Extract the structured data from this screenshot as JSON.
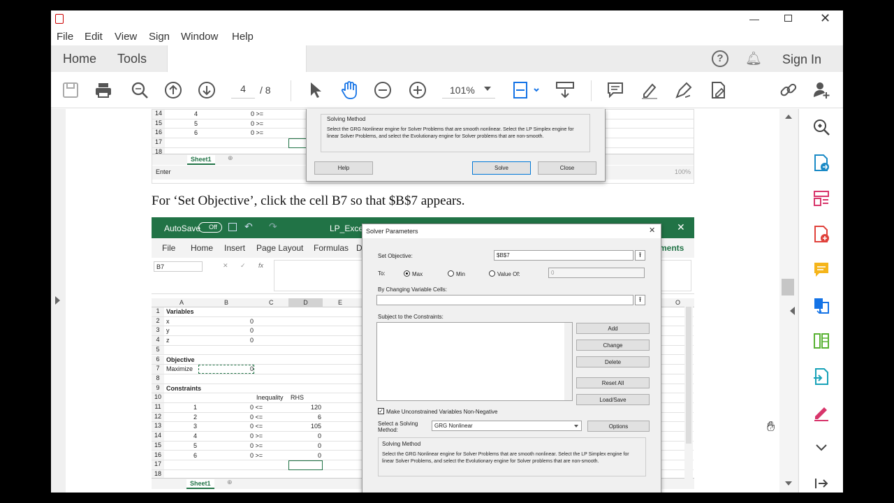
{
  "menu": [
    "File",
    "Edit",
    "View",
    "Sign",
    "Window",
    "Help"
  ],
  "tabs": {
    "home": "Home",
    "tools": "Tools"
  },
  "header": {
    "sign_in": "Sign In"
  },
  "toolbar": {
    "page_current": "4",
    "page_sep": "/ 8",
    "zoom": "101%"
  },
  "top_excel": {
    "rows": [
      {
        "n": "14",
        "a": "4",
        "b": "0 >="
      },
      {
        "n": "15",
        "a": "5",
        "b": "0 >="
      },
      {
        "n": "16",
        "a": "6",
        "b": "0 >="
      },
      {
        "n": "17",
        "a": "",
        "b": ""
      },
      {
        "n": "18",
        "a": "",
        "b": ""
      }
    ],
    "sheet_tab": "Sheet1",
    "status": "Enter",
    "zoom_status": "100%"
  },
  "top_dialog": {
    "section": "Solving Method",
    "desc": "Select the GRG Nonlinear engine for Solver Problems that are smooth nonlinear. Select the LP Simplex engine for linear Solver Problems, and select the Evolutionary engine for Solver problems that are non-smooth.",
    "help": "Help",
    "solve": "Solve",
    "close": "Close"
  },
  "instruction": "For ‘Set Objective’, click the cell B7 so that $B$7 appears.",
  "excel": {
    "autosave": "AutoSave",
    "toggle": "Off",
    "file": "LP_ExcelS",
    "ribbon": [
      "File",
      "Home",
      "Insert",
      "Page Layout",
      "Formulas",
      "D"
    ],
    "ribbon_right": "ments",
    "namebox": "B7",
    "cols": [
      "A",
      "B",
      "C",
      "D",
      "E"
    ],
    "col_o": "O",
    "rows": [
      {
        "n": "1",
        "a": "Variables",
        "b": "",
        "c": "",
        "d": "",
        "bold": true
      },
      {
        "n": "2",
        "a": "x",
        "b": "0",
        "c": "",
        "d": ""
      },
      {
        "n": "3",
        "a": "y",
        "b": "0",
        "c": "",
        "d": ""
      },
      {
        "n": "4",
        "a": "z",
        "b": "0",
        "c": "",
        "d": ""
      },
      {
        "n": "5",
        "a": "",
        "b": "",
        "c": "",
        "d": ""
      },
      {
        "n": "6",
        "a": "Objective",
        "b": "",
        "c": "",
        "d": "",
        "bold": true
      },
      {
        "n": "7",
        "a": "Maximize",
        "b": "0",
        "c": "",
        "d": ""
      },
      {
        "n": "8",
        "a": "",
        "b": "",
        "c": "",
        "d": ""
      },
      {
        "n": "9",
        "a": "Constraints",
        "b": "",
        "c": "",
        "d": "",
        "bold": true
      },
      {
        "n": "10",
        "a": "",
        "b": "",
        "c": "Inequality",
        "d": "RHS"
      },
      {
        "n": "11",
        "a": "1",
        "b": "0 <=",
        "c": "",
        "d": "120"
      },
      {
        "n": "12",
        "a": "2",
        "b": "0 <=",
        "c": "",
        "d": "6"
      },
      {
        "n": "13",
        "a": "3",
        "b": "0 <=",
        "c": "",
        "d": "105"
      },
      {
        "n": "14",
        "a": "4",
        "b": "0 >=",
        "c": "",
        "d": "0"
      },
      {
        "n": "15",
        "a": "5",
        "b": "0 >=",
        "c": "",
        "d": "0"
      },
      {
        "n": "16",
        "a": "6",
        "b": "0 >=",
        "c": "",
        "d": "0"
      },
      {
        "n": "17",
        "a": "",
        "b": "",
        "c": "",
        "d": ""
      },
      {
        "n": "18",
        "a": "",
        "b": "",
        "c": "",
        "d": ""
      }
    ],
    "sheet_tab": "Sheet1"
  },
  "solver": {
    "title": "Solver Parameters",
    "set_objective": "Set Objective:",
    "objective_value": "$B$7",
    "to": "To:",
    "max": "Max",
    "min": "Min",
    "value_of": "Value Of:",
    "value_of_input": "0",
    "by_changing": "By Changing Variable Cells:",
    "subject": "Subject to the Constraints:",
    "add": "Add",
    "change": "Change",
    "delete": "Delete",
    "reset_all": "Reset All",
    "load_save": "Load/Save",
    "nonneg": "Make Unconstrained Variables Non-Negative",
    "select_method": "Select a Solving Method:",
    "method": "GRG Nonlinear",
    "options": "Options",
    "section": "Solving Method",
    "desc": "Select the GRG Nonlinear engine for Solver Problems that are smooth nonlinear. Select the LP Simplex engine for linear Solver Problems, and select the Evolutionary engine for Solver problems that are non-smooth."
  }
}
